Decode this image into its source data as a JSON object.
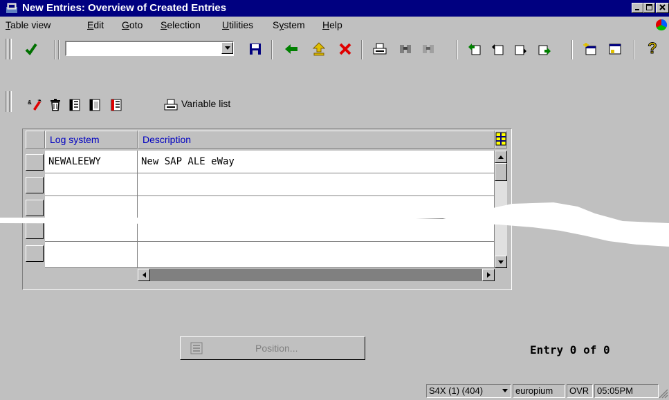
{
  "window": {
    "title": "New Entries: Overview of Created Entries",
    "controls": [
      "minimize",
      "maximize",
      "close"
    ]
  },
  "menu": {
    "items": [
      {
        "label": "Table view",
        "mnemonic": "T"
      },
      {
        "label": "Edit",
        "mnemonic": "E"
      },
      {
        "label": "Goto",
        "mnemonic": "G"
      },
      {
        "label": "Selection",
        "mnemonic": "S"
      },
      {
        "label": "Utilities",
        "mnemonic": "U"
      },
      {
        "label": "System",
        "mnemonic": "y"
      },
      {
        "label": "Help",
        "mnemonic": "H"
      }
    ]
  },
  "toolbar": {
    "command_field": {
      "value": "",
      "placeholder": ""
    },
    "icons": [
      "enter-checkmark-icon",
      "save-icon",
      "back-icon",
      "exit-icon",
      "cancel-icon",
      "print-icon",
      "find-icon",
      "find-next-icon",
      "first-page-icon",
      "previous-page-icon",
      "next-page-icon",
      "last-page-icon",
      "create-session-icon",
      "shortcut-icon",
      "help-icon"
    ]
  },
  "app_toolbar": {
    "icons": [
      "change-display-icon",
      "delete-icon",
      "select-all-icon",
      "deselect-all-icon",
      "select-block-icon",
      "print-icon"
    ],
    "variable_list_label": "Variable list"
  },
  "table": {
    "columns": [
      "Log system",
      "Description"
    ],
    "rows": [
      {
        "log_system": "NEWALEEWY",
        "description": "New SAP ALE eWay"
      },
      {
        "log_system": "",
        "description": ""
      },
      {
        "log_system": "",
        "description": ""
      },
      {
        "log_system": "",
        "description": ""
      },
      {
        "log_system": "",
        "description": ""
      }
    ]
  },
  "footer": {
    "position_button_label": "Position...",
    "entry_count_text": "Entry 0 of 0"
  },
  "statusbar": {
    "system": "S4X (1) (404)",
    "server": "europium",
    "mode": "OVR",
    "time": "05:05PM"
  },
  "colors": {
    "title_bar": "#000080",
    "background": "#c0c0c0",
    "header_text": "#0000c0"
  }
}
